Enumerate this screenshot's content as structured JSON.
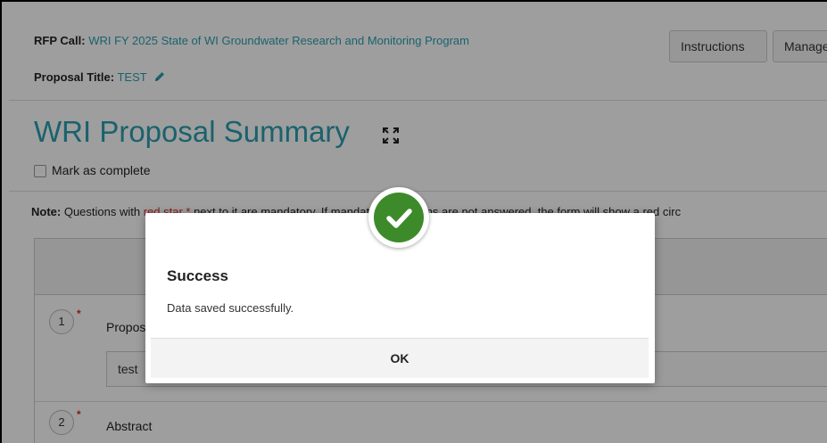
{
  "header": {
    "rfp_label": "RFP Call:",
    "rfp_value": "WRI FY 2025 State of WI Groundwater Research and Monitoring Program",
    "proposal_title_label": "Proposal Title:",
    "proposal_title_value": "TEST",
    "buttons": {
      "instructions": "Instructions",
      "manage": "Manage"
    }
  },
  "summary": {
    "title": "WRI Proposal Summary",
    "mark_complete_label": "Mark as complete"
  },
  "note": {
    "label": "Note:",
    "text_before": " Questions with ",
    "red_star": "red star *",
    "text_after": " next to it are mandatory. If mandatory questions are not answered, the form will show a red circ"
  },
  "questions": [
    {
      "number": "1",
      "label": "Propos",
      "answer": "test"
    },
    {
      "number": "2",
      "label": "Abstract"
    }
  ],
  "modal": {
    "title": "Success",
    "message": "Data saved successfully.",
    "ok_label": "OK"
  },
  "colors": {
    "accent": "#2a9fb0",
    "success": "#3d8a2a",
    "required": "#d92b2b"
  }
}
